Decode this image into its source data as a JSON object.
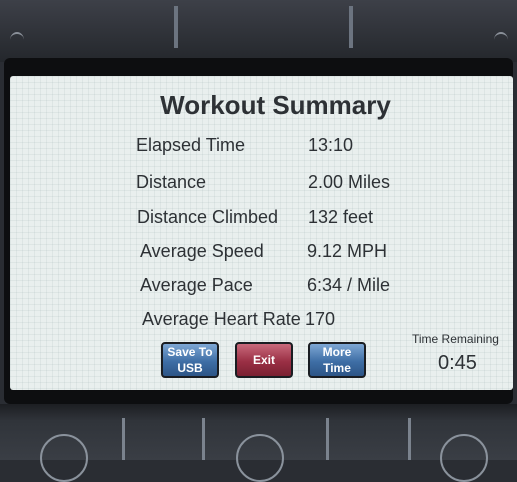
{
  "summary": {
    "title": "Workout Summary",
    "rows": [
      {
        "label": "Elapsed Time",
        "value": "13:10"
      },
      {
        "label": "Distance",
        "value": "2.00 Miles"
      },
      {
        "label": "Distance Climbed",
        "value": "132 feet"
      },
      {
        "label": "Average Speed",
        "value": "9.12 MPH"
      },
      {
        "label": "Average Pace",
        "value": "6:34 / Mile"
      },
      {
        "label": "Average Heart Rate",
        "value": "170"
      }
    ]
  },
  "buttons": {
    "save_usb": "Save To\nUSB",
    "exit": "Exit",
    "more_time": "More\nTime"
  },
  "time_remaining": {
    "label": "Time Remaining",
    "value": "0:45"
  },
  "colors": {
    "screen_bg": "#e9efee",
    "text": "#2d3135",
    "button_blue": "#3e6ea5",
    "button_red": "#9a2f44"
  }
}
